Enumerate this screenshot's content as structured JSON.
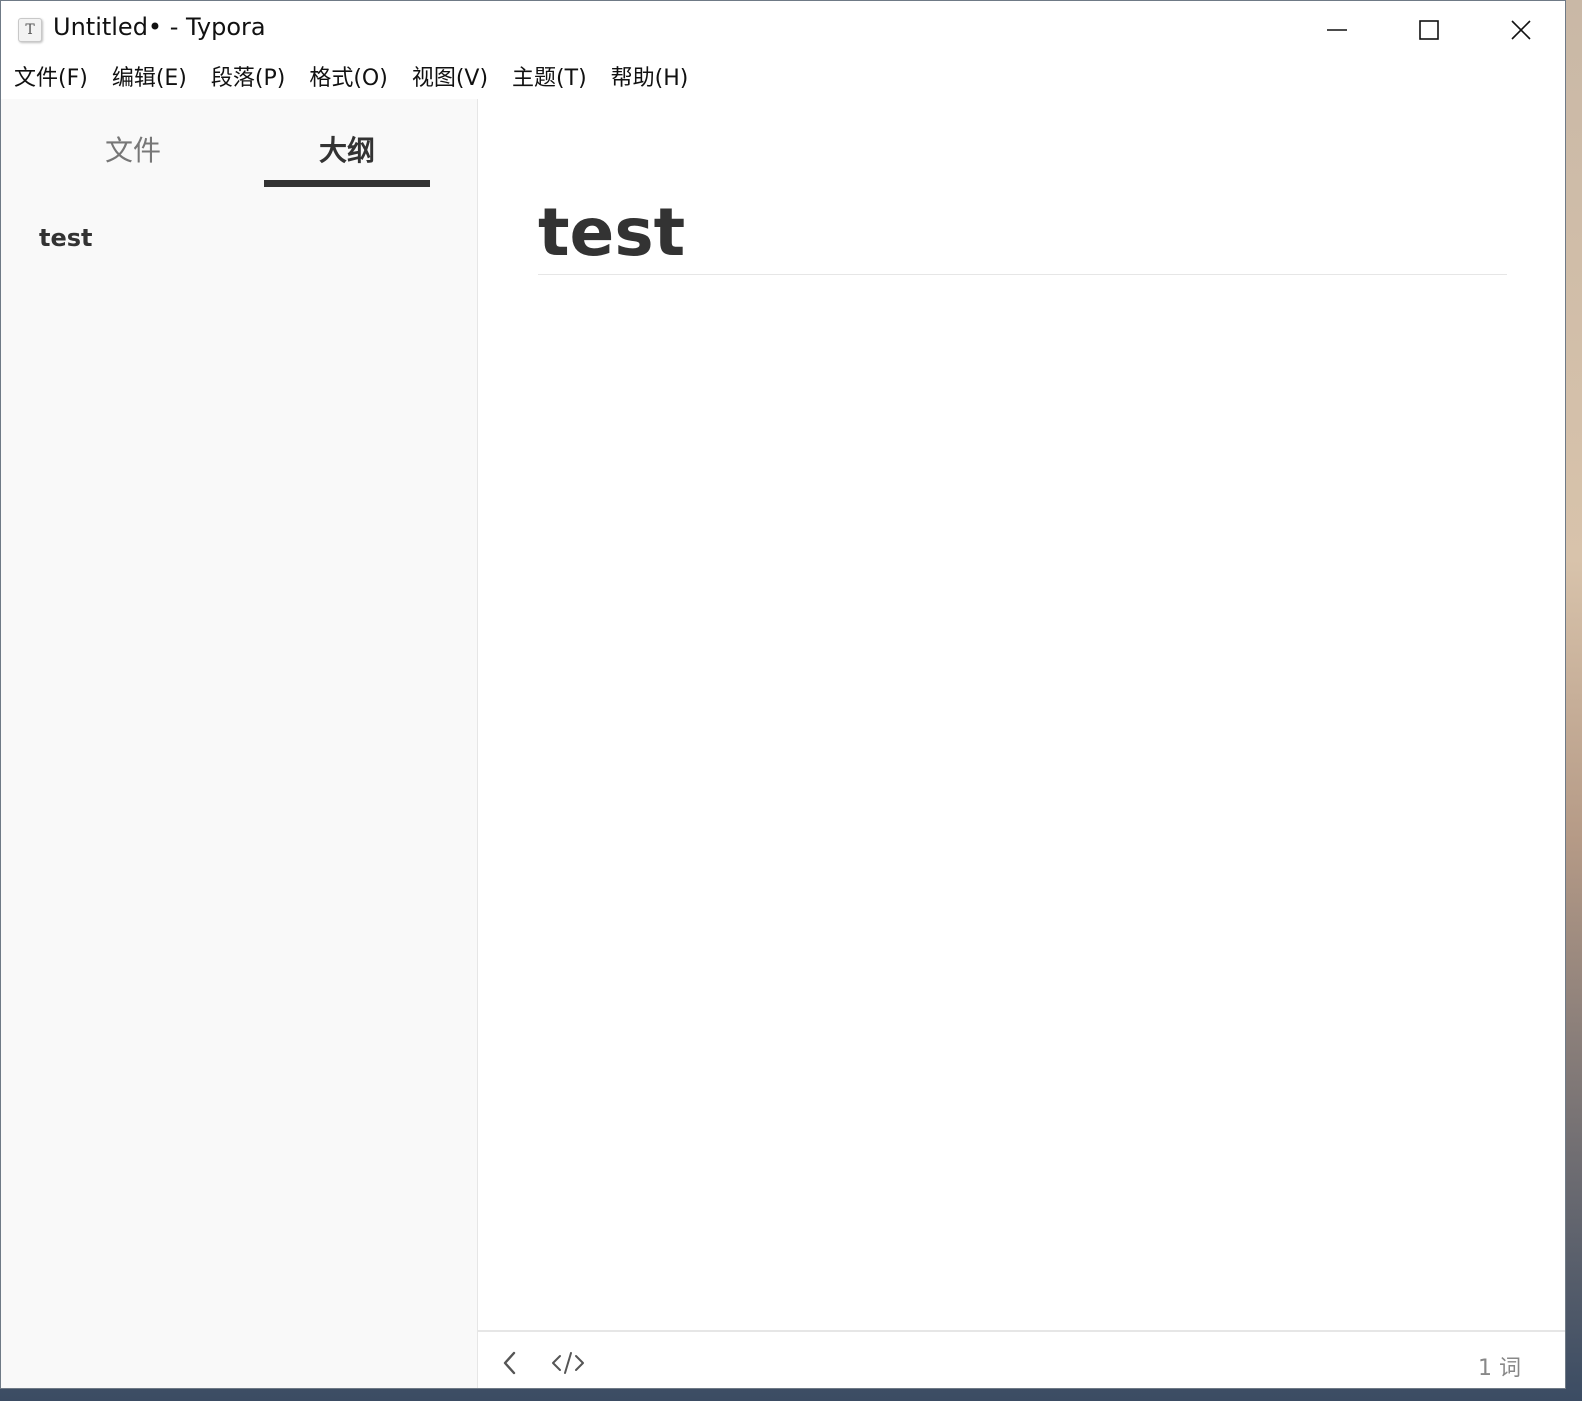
{
  "window": {
    "title": "Untitled• - Typora",
    "app_icon_letter": "T",
    "controls": {
      "minimize_icon": "minimize-icon",
      "maximize_icon": "maximize-icon",
      "close_icon": "close-icon"
    }
  },
  "menubar": {
    "items": [
      "文件(F)",
      "编辑(E)",
      "段落(P)",
      "格式(O)",
      "视图(V)",
      "主题(T)",
      "帮助(H)"
    ]
  },
  "sidebar": {
    "tabs": [
      {
        "label": "文件",
        "active": false
      },
      {
        "label": "大纲",
        "active": true
      }
    ],
    "outline": [
      "test"
    ]
  },
  "editor": {
    "heading": "test"
  },
  "footer": {
    "toggle_sidebar_icon": "chevron-left-icon",
    "source_mode_icon": "code-icon",
    "word_count": "1 词"
  },
  "colors": {
    "text": "#333333",
    "sidebar_bg": "#f9f9f9",
    "muted": "#888888",
    "divider": "#e6e6e6"
  }
}
